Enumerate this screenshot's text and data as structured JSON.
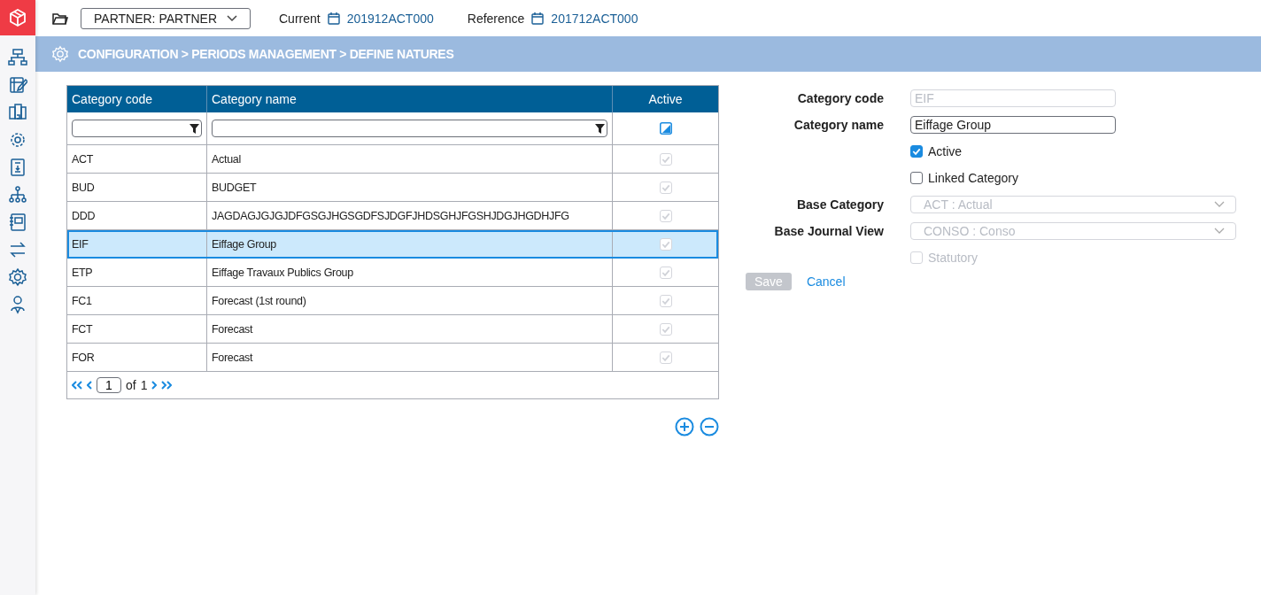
{
  "topbar": {
    "partner": "PARTNER: PARTNER",
    "current_label": "Current",
    "current_value": "201912ACT000",
    "reference_label": "Reference",
    "reference_value": "201712ACT000"
  },
  "breadcrumb": "CONFIGURATION > PERIODS MANAGEMENT > DEFINE NATURES",
  "table": {
    "columns": [
      "Category code",
      "Category name",
      "Active"
    ],
    "active_filter": {
      "indeterminate": true
    },
    "rows": [
      {
        "code": "ACT",
        "name": "Actual",
        "active": true,
        "disabled": true,
        "selected": false
      },
      {
        "code": "BUD",
        "name": "BUDGET",
        "active": true,
        "disabled": true,
        "selected": false
      },
      {
        "code": "DDD",
        "name": "JAGDAGJGJGJDFGSGJHGSGDFSJDGFJHDSGHJFGSHJDGJHGDHJFG",
        "active": true,
        "disabled": true,
        "selected": false
      },
      {
        "code": "EIF",
        "name": "Eiffage Group",
        "active": true,
        "disabled": true,
        "selected": true
      },
      {
        "code": "ETP",
        "name": "Eiffage Travaux Publics Group",
        "active": true,
        "disabled": true,
        "selected": false
      },
      {
        "code": "FC1",
        "name": "Forecast (1st round)",
        "active": true,
        "disabled": true,
        "selected": false
      },
      {
        "code": "FCT",
        "name": "Forecast",
        "active": true,
        "disabled": true,
        "selected": false
      },
      {
        "code": "FOR",
        "name": "Forecast",
        "active": true,
        "disabled": true,
        "selected": false
      }
    ],
    "pager": {
      "page": "1",
      "of_label": "of",
      "total": "1"
    }
  },
  "form": {
    "fields": [
      {
        "kind": "input",
        "label": "Category code",
        "value": "EIF",
        "disabled": true
      },
      {
        "kind": "input",
        "label": "Category name",
        "value": "Eiffage Group",
        "disabled": false
      },
      {
        "kind": "checkbox",
        "label": "Active",
        "checked": true,
        "disabled": false
      },
      {
        "kind": "checkbox",
        "label": "Linked Category",
        "checked": false,
        "disabled": false
      },
      {
        "kind": "select",
        "label": "Base Category",
        "value": "ACT : Actual",
        "disabled": true
      },
      {
        "kind": "select",
        "label": "Base Journal View",
        "value": "CONSO : Conso",
        "disabled": true
      },
      {
        "kind": "checkbox",
        "label": "Statutory",
        "checked": false,
        "disabled": true
      }
    ],
    "save": {
      "label": "Save",
      "disabled": true
    },
    "cancel": "Cancel"
  }
}
